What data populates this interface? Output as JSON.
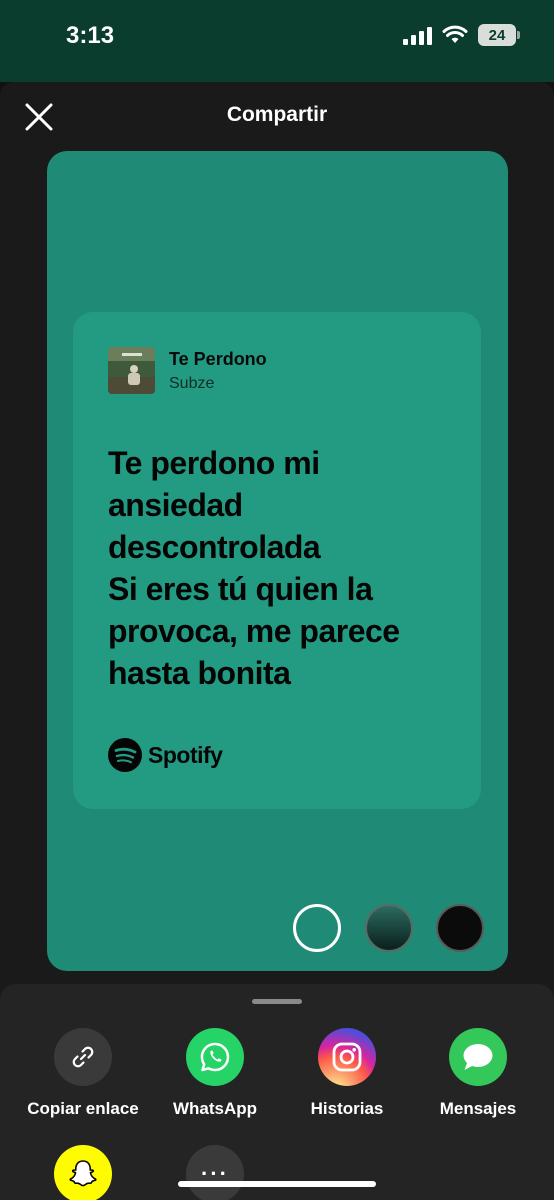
{
  "status_bar": {
    "time": "3:13",
    "battery": "24"
  },
  "header": {
    "title": "Compartir",
    "close_icon": "close-icon"
  },
  "card": {
    "song_title": "Te Perdono",
    "artist": "Subze",
    "lyrics": "Te perdono mi\nansiedad\ndescontrolada\nSi eres tú quien la\nprovoca, me parece\nhasta bonita",
    "brand": "Spotify",
    "background_color": "#1f8a75",
    "card_color": "#239b83"
  },
  "color_options": [
    {
      "name": "teal",
      "color": "#1f8a75",
      "selected": true
    },
    {
      "name": "dark-green-gradient",
      "color": "#0a1f1b",
      "selected": false
    },
    {
      "name": "black",
      "color": "#0b0b0b",
      "selected": false
    }
  ],
  "share": {
    "items": [
      {
        "label": "Copiar enlace",
        "icon": "link-icon"
      },
      {
        "label": "WhatsApp",
        "icon": "whatsapp-icon"
      },
      {
        "label": "Historias",
        "icon": "instagram-icon"
      },
      {
        "label": "Mensajes",
        "icon": "messages-icon"
      }
    ],
    "more_label": "···"
  }
}
